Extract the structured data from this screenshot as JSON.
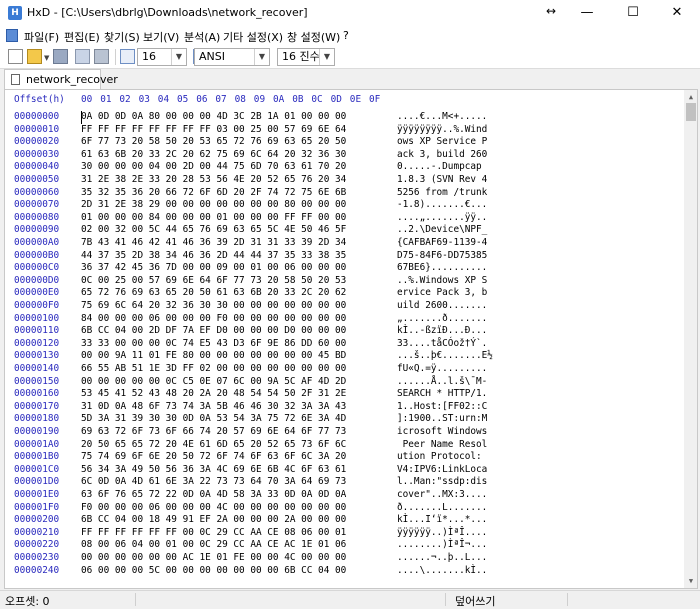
{
  "window": {
    "title": "HxD - [C:\\Users\\dbrlg\\Downloads\\network_recover]",
    "controls": {
      "minimize": "—",
      "maximize": "☐",
      "close": "✕",
      "resize_marker": "↔"
    }
  },
  "menu": {
    "items": [
      "파일(F)",
      "편집(E)",
      "찾기(S)",
      "보기(V)",
      "분석(A)",
      "기타 설정(X)",
      "창 설정(W)",
      "?"
    ]
  },
  "toolbar": {
    "bytes_per_row": "16",
    "charset": "ANSI",
    "offset_base": "16 진수"
  },
  "tab": {
    "label": "network_recover"
  },
  "hex_view": {
    "offset_header": "Offset(h)",
    "columns": [
      "00",
      "01",
      "02",
      "03",
      "04",
      "05",
      "06",
      "07",
      "08",
      "09",
      "0A",
      "0B",
      "0C",
      "0D",
      "0E",
      "0F"
    ],
    "rows": [
      {
        "offset": "00000000",
        "hex": "0A 0D 0D 0A 80 00 00 00 4D 3C 2B 1A 01 00 00 00",
        "text": "....€...M<+....."
      },
      {
        "offset": "00000010",
        "hex": "FF FF FF FF FF FF FF FF 03 00 25 00 57 69 6E 64",
        "text": "ÿÿÿÿÿÿÿÿ..%.Wind"
      },
      {
        "offset": "00000020",
        "hex": "6F 77 73 20 58 50 20 53 65 72 76 69 63 65 20 50",
        "text": "ows XP Service P"
      },
      {
        "offset": "00000030",
        "hex": "61 63 6B 20 33 2C 20 62 75 69 6C 64 20 32 36 30",
        "text": "ack 3, build 260"
      },
      {
        "offset": "00000040",
        "hex": "30 00 00 00 04 00 2D 00 44 75 6D 70 63 61 70 20",
        "text": "0.....-.Dumpcap "
      },
      {
        "offset": "00000050",
        "hex": "31 2E 38 2E 33 20 28 53 56 4E 20 52 65 76 20 34",
        "text": "1.8.3 (SVN Rev 4"
      },
      {
        "offset": "00000060",
        "hex": "35 32 35 36 20 66 72 6F 6D 20 2F 74 72 75 6E 6B",
        "text": "5256 from /trunk"
      },
      {
        "offset": "00000070",
        "hex": "2D 31 2E 38 29 00 00 00 00 00 00 00 80 00 00 00",
        "text": "-1.8).......€..."
      },
      {
        "offset": "00000080",
        "hex": "01 00 00 00 84 00 00 00 01 00 00 00 FF FF 00 00",
        "text": "....„.......ÿÿ.."
      },
      {
        "offset": "00000090",
        "hex": "02 00 32 00 5C 44 65 76 69 63 65 5C 4E 50 46 5F",
        "text": "..2.\\Device\\NPF_"
      },
      {
        "offset": "000000A0",
        "hex": "7B 43 41 46 42 41 46 36 39 2D 31 31 33 39 2D 34",
        "text": "{CAFBAF69-1139-4"
      },
      {
        "offset": "000000B0",
        "hex": "44 37 35 2D 38 34 46 36 2D 44 44 37 35 33 38 35",
        "text": "D75-84F6-DD75385"
      },
      {
        "offset": "000000C0",
        "hex": "36 37 42 45 36 7D 00 00 09 00 01 00 06 00 00 00",
        "text": "67BE6}.........."
      },
      {
        "offset": "000000D0",
        "hex": "0C 00 25 00 57 69 6E 64 6F 77 73 20 58 50 20 53",
        "text": "..%.Windows XP S"
      },
      {
        "offset": "000000E0",
        "hex": "65 72 76 69 63 65 20 50 61 63 6B 20 33 2C 20 62",
        "text": "ervice Pack 3, b"
      },
      {
        "offset": "000000F0",
        "hex": "75 69 6C 64 20 32 36 30 30 00 00 00 00 00 00 00",
        "text": "uild 2600......."
      },
      {
        "offset": "00000100",
        "hex": "84 00 00 00 06 00 00 00 F0 00 00 00 00 00 00 00",
        "text": "„.......ð......."
      },
      {
        "offset": "00000110",
        "hex": "6B CC 04 00 2D DF 7A EF D0 00 00 00 D0 00 00 00",
        "text": "kÌ..-ßzïÐ...Ð..."
      },
      {
        "offset": "00000120",
        "hex": "33 33 00 00 00 0C 74 E5 43 D3 6F 9E 86 DD 60 00",
        "text": "33....tåCÓož†Ý`."
      },
      {
        "offset": "00000130",
        "hex": "00 00 9A 11 01 FE 80 00 00 00 00 00 00 00 45 BD",
        "text": "...š..þ€.......E½"
      },
      {
        "offset": "00000140",
        "hex": "66 55 AB 51 1E 3D FF 02 00 00 00 00 00 00 00 00",
        "text": "fU«Q.=ÿ........."
      },
      {
        "offset": "00000150",
        "hex": "00 00 00 00 00 0C C5 0E 07 6C 00 9A 5C AF 4D 2D",
        "text": "......Å..l.š\\¯M-"
      },
      {
        "offset": "00000160",
        "hex": "53 45 41 52 43 48 20 2A 20 48 54 54 50 2F 31 2E",
        "text": "SEARCH * HTTP/1."
      },
      {
        "offset": "00000170",
        "hex": "31 0D 0A 48 6F 73 74 3A 5B 46 46 30 32 3A 3A 43",
        "text": "1..Host:[FF02::C"
      },
      {
        "offset": "00000180",
        "hex": "5D 3A 31 39 30 30 0D 0A 53 54 3A 75 72 6E 3A 4D",
        "text": "]:1900..ST:urn:M"
      },
      {
        "offset": "00000190",
        "hex": "69 63 72 6F 73 6F 66 74 20 57 69 6E 64 6F 77 73",
        "text": "icrosoft Windows"
      },
      {
        "offset": "000001A0",
        "hex": "20 50 65 65 72 20 4E 61 6D 65 20 52 65 73 6F 6C",
        "text": " Peer Name Resol"
      },
      {
        "offset": "000001B0",
        "hex": "75 74 69 6F 6E 20 50 72 6F 74 6F 63 6F 6C 3A 20",
        "text": "ution Protocol: "
      },
      {
        "offset": "000001C0",
        "hex": "56 34 3A 49 50 56 36 3A 4C 69 6E 6B 4C 6F 63 61",
        "text": "V4:IPV6:LinkLoca"
      },
      {
        "offset": "000001D0",
        "hex": "6C 0D 0A 4D 61 6E 3A 22 73 73 64 70 3A 64 69 73",
        "text": "l..Man:\"ssdp:dis"
      },
      {
        "offset": "000001E0",
        "hex": "63 6F 76 65 72 22 0D 0A 4D 58 3A 33 0D 0A 0D 0A",
        "text": "cover\"..MX:3...."
      },
      {
        "offset": "000001F0",
        "hex": "F0 00 00 00 06 00 00 00 4C 00 00 00 00 00 00 00",
        "text": "ð.......L......."
      },
      {
        "offset": "00000200",
        "hex": "6B CC 04 00 18 49 91 EF 2A 00 00 00 2A 00 00 00",
        "text": "kÌ...I‘ï*...*..."
      },
      {
        "offset": "00000210",
        "hex": "FF FF FF FF FF FF 00 0C 29 CC AA CE 08 06 00 01",
        "text": "ÿÿÿÿÿÿ..)ÌªÎ...."
      },
      {
        "offset": "00000220",
        "hex": "08 00 06 04 00 01 00 0C 29 CC AA CE AC 1E 01 06",
        "text": "........)ÌªÎ¬..."
      },
      {
        "offset": "00000230",
        "hex": "00 00 00 00 00 00 AC 1E 01 FE 00 00 4C 00 00 00",
        "text": "......¬..þ..L..."
      },
      {
        "offset": "00000240",
        "hex": "06 00 00 00 5C 00 00 00 00 00 00 00 6B CC 04 00",
        "text": "....\\.......kÌ.."
      }
    ]
  },
  "statusbar": {
    "offset": "오프셋: 0",
    "mode": "덮어쓰기"
  }
}
